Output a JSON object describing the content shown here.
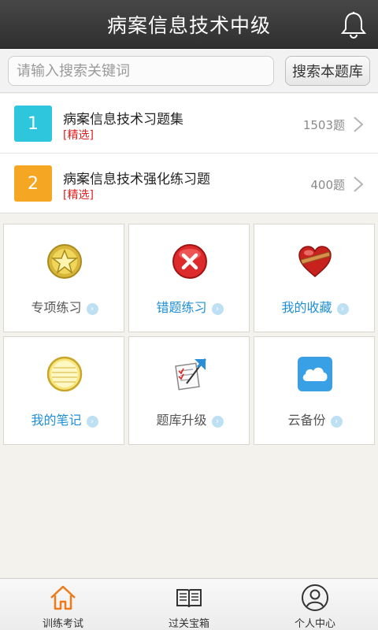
{
  "header": {
    "title": "病案信息技术中级",
    "bell_icon": "bell-icon"
  },
  "search": {
    "placeholder": "请输入搜索关键词",
    "button_label": "搜索本题库"
  },
  "banks": [
    {
      "number": "1",
      "title": "病案信息技术习题集",
      "tag": "[精选]",
      "count": "1503题",
      "color": "#2dc6dc"
    },
    {
      "number": "2",
      "title": "病案信息技术强化练习题",
      "tag": "[精选]",
      "count": "400题",
      "color": "#f5a623"
    }
  ],
  "grid": [
    {
      "label": "专项练习",
      "icon": "star-medal-icon"
    },
    {
      "label": "错题练习",
      "icon": "red-x-icon"
    },
    {
      "label": "我的收藏",
      "icon": "heart-icon"
    },
    {
      "label": "我的笔记",
      "icon": "notepad-icon"
    },
    {
      "label": "题库升级",
      "icon": "upgrade-document-icon"
    },
    {
      "label": "云备份",
      "icon": "cloud-icon"
    }
  ],
  "bottom_nav": [
    {
      "label": "训练考试",
      "icon": "home-icon",
      "active": true
    },
    {
      "label": "过关宝箱",
      "icon": "book-icon"
    },
    {
      "label": "个人中心",
      "icon": "user-icon"
    }
  ],
  "colors": {
    "accent_blue": "#1e8fd6",
    "tag_red": "#e02020",
    "header_bg": "#3a3a3a"
  }
}
